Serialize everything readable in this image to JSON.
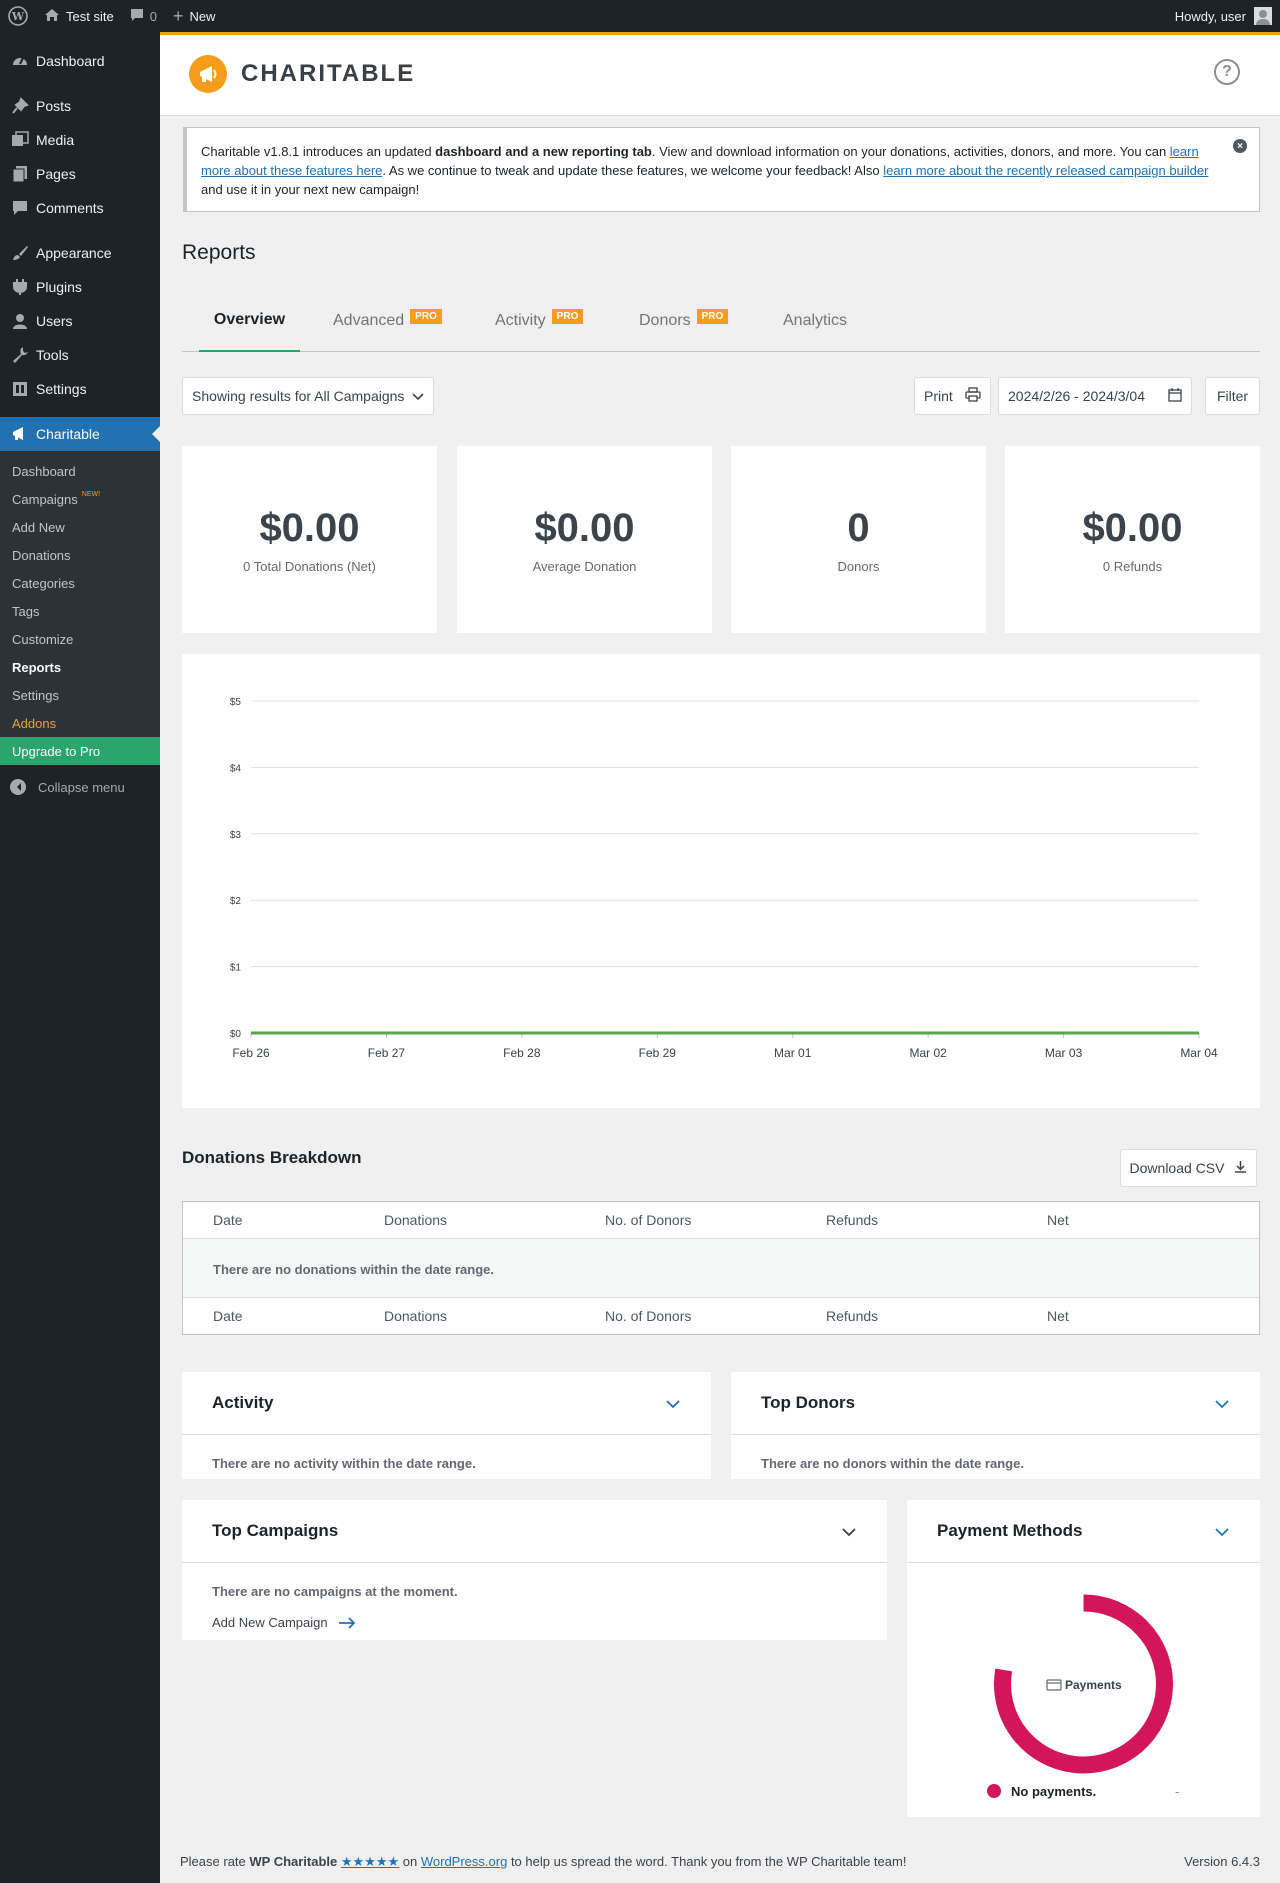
{
  "adminbar": {
    "site_name": "Test site",
    "comments_count": "0",
    "new_label": "New",
    "howdy": "Howdy, user"
  },
  "sidebar": {
    "top_items": [
      {
        "label": "Dashboard",
        "icon": "dashboard-icon"
      },
      {
        "label": "Posts",
        "icon": "pin-icon"
      },
      {
        "label": "Media",
        "icon": "media-icon"
      },
      {
        "label": "Pages",
        "icon": "pages-icon"
      },
      {
        "label": "Comments",
        "icon": "comments-icon"
      },
      {
        "label": "Appearance",
        "icon": "brush-icon"
      },
      {
        "label": "Plugins",
        "icon": "plugin-icon"
      },
      {
        "label": "Users",
        "icon": "users-icon"
      },
      {
        "label": "Tools",
        "icon": "wrench-icon"
      },
      {
        "label": "Settings",
        "icon": "settings-icon"
      }
    ],
    "charitable_label": "Charitable",
    "submenu": [
      {
        "label": "Dashboard"
      },
      {
        "label": "Campaigns",
        "badge": "NEW!"
      },
      {
        "label": "Add New"
      },
      {
        "label": "Donations"
      },
      {
        "label": "Categories"
      },
      {
        "label": "Tags"
      },
      {
        "label": "Customize"
      },
      {
        "label": "Reports"
      },
      {
        "label": "Settings"
      },
      {
        "label": "Addons"
      },
      {
        "label": "Upgrade to Pro"
      }
    ],
    "collapse_label": "Collapse menu"
  },
  "header": {
    "brand": "CHARITABLE",
    "help": "?"
  },
  "notice": {
    "part1": "Charitable v1.8.1 introduces an updated ",
    "bold": "dashboard and a new reporting tab",
    "part2": ". View and download information on your donations, activities, donors, and more. You can ",
    "link1": "learn more about these features here",
    "part3": ". As we continue to tweak and update these features, we welcome your feedback! Also ",
    "link2": "learn more about the recently released campaign builder",
    "part4": " and use it in your next new campaign!",
    "close": "×"
  },
  "page_title": "Reports",
  "tabs": [
    {
      "label": "Overview"
    },
    {
      "label": "Advanced",
      "badge": "PRO"
    },
    {
      "label": "Activity",
      "badge": "PRO"
    },
    {
      "label": "Donors",
      "badge": "PRO"
    },
    {
      "label": "Analytics"
    }
  ],
  "filters": {
    "campaign_select": "Showing results for All Campaigns",
    "print_label": "Print",
    "date_range": "2024/2/26 - 2024/3/04",
    "filter_label": "Filter"
  },
  "stats": [
    {
      "value": "$0.00",
      "label": "0 Total Donations (Net)"
    },
    {
      "value": "$0.00",
      "label": "Average Donation"
    },
    {
      "value": "0",
      "label": "Donors"
    },
    {
      "value": "$0.00",
      "label": "0 Refunds"
    }
  ],
  "chart_data": {
    "type": "line",
    "x": [
      "Feb 26",
      "Feb 27",
      "Feb 28",
      "Feb 29",
      "Mar 01",
      "Mar 02",
      "Mar 03",
      "Mar 04"
    ],
    "y_ticks": [
      "$0",
      "$1",
      "$2",
      "$3",
      "$4",
      "$5"
    ],
    "ylim": [
      0,
      5
    ],
    "series": [
      {
        "values": [
          0,
          0,
          0,
          0,
          0,
          0,
          0,
          0
        ],
        "color": "#5aa54a"
      }
    ],
    "grid": true
  },
  "breakdown": {
    "title": "Donations Breakdown",
    "download_label": "Download CSV",
    "columns": [
      "Date",
      "Donations",
      "No. of Donors",
      "Refunds",
      "Net"
    ],
    "empty_message": "There are no donations within the date range."
  },
  "widgets": {
    "activity": {
      "title": "Activity",
      "empty": "There are no activity within the date range."
    },
    "top_donors": {
      "title": "Top Donors",
      "empty": "There are no donors within the date range."
    },
    "top_campaigns": {
      "title": "Top Campaigns",
      "empty": "There are no campaigns at the moment.",
      "add_link": "Add New Campaign"
    },
    "payment_methods": {
      "title": "Payment Methods",
      "center_label": "Payments",
      "legend_label": "No payments.",
      "legend_value": "-"
    }
  },
  "footer": {
    "p1": "Please rate ",
    "bold": "WP Charitable",
    "stars": "★★★★★",
    "p2": " on ",
    "link": "WordPress.org",
    "p3": " to help us spread the word. Thank you from the WP Charitable team!",
    "version": "Version 6.4.3"
  },
  "colors": {
    "accent": "#f89c1c",
    "wp_blue": "#2271b1",
    "success_green": "#2aa56b",
    "donut": "#d3155c"
  }
}
